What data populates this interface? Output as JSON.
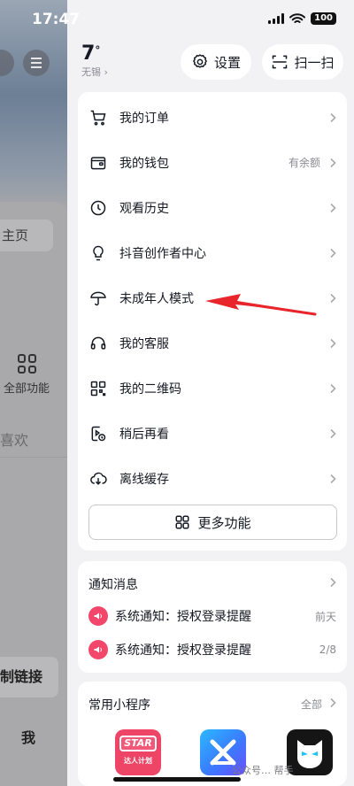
{
  "status_bar": {
    "time": "17:47",
    "battery": "100"
  },
  "background_page": {
    "home_tab": "主页",
    "all_functions": "全部功能",
    "likes_partial": "喜欢",
    "copy_link_partial": "制链接",
    "me_tab": "我"
  },
  "drawer": {
    "weather": {
      "temp": "7",
      "unit": "°",
      "city": "无锡"
    },
    "settings_label": "设置",
    "scan_label": "扫一扫",
    "menu": [
      {
        "label": "我的订单",
        "icon": "cart-icon",
        "extra": ""
      },
      {
        "label": "我的钱包",
        "icon": "wallet-icon",
        "extra": "有余额"
      },
      {
        "label": "观看历史",
        "icon": "clock-icon",
        "extra": ""
      },
      {
        "label": "抖音创作者中心",
        "icon": "lightbulb-icon",
        "extra": ""
      },
      {
        "label": "未成年人模式",
        "icon": "umbrella-icon",
        "extra": ""
      },
      {
        "label": "我的客服",
        "icon": "headset-icon",
        "extra": ""
      },
      {
        "label": "我的二维码",
        "icon": "qrcode-icon",
        "extra": ""
      },
      {
        "label": "稍后再看",
        "icon": "watch-later-icon",
        "extra": ""
      },
      {
        "label": "离线缓存",
        "icon": "cloud-download-icon",
        "extra": ""
      }
    ],
    "more_functions": "更多功能",
    "notifications": {
      "title": "通知消息",
      "items": [
        {
          "text": "系统通知：授权登录提醒",
          "time": "前天"
        },
        {
          "text": "系统通知：授权登录提醒",
          "time": "2/8"
        }
      ]
    },
    "mini_programs": {
      "title": "常用小程序",
      "all_label": "全部",
      "apps": [
        {
          "name": "star-plan-app",
          "logo_text": "STAR",
          "logo_subtext": "达人计划"
        },
        {
          "name": "capcut-app"
        },
        {
          "name": "mask-app"
        }
      ]
    }
  },
  "watermark": "公众号… 帮手",
  "colors": {
    "annotation_arrow": "#e8252b",
    "notice_icon": "#f2476a"
  }
}
